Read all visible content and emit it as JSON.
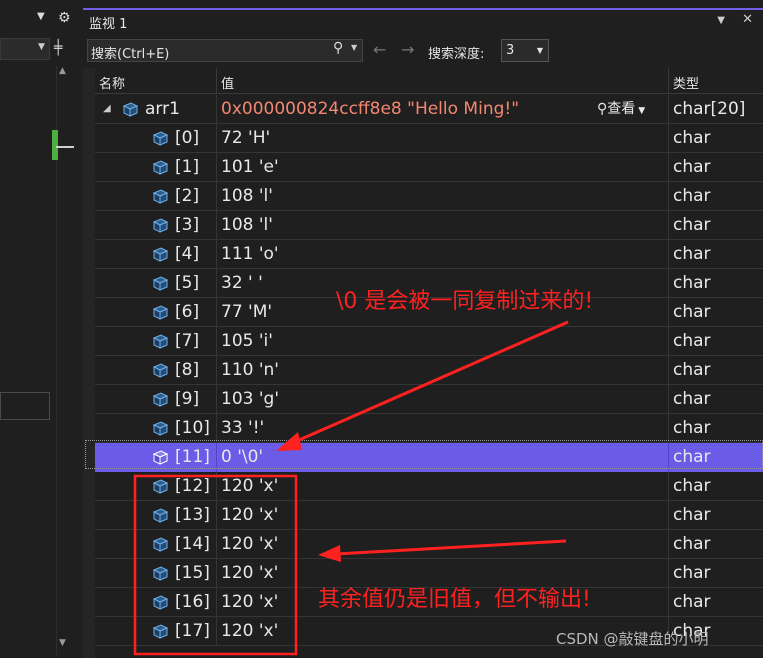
{
  "watch_window": {
    "title": "监视 1",
    "accent_color": "#7160e8",
    "title_buttons": [
      "chevron-down-icon",
      "close-icon"
    ],
    "search_placeholder": "搜索(Ctrl+E)",
    "search_icon": "search-icon",
    "depth_label": "搜索深度:",
    "depth_value": "3",
    "columns": {
      "name": "名称",
      "value": "值",
      "type": "类型"
    },
    "root": {
      "name": "arr1",
      "value": "0x000000824ccff8e8 \"Hello Ming!\"",
      "view_label": "查看",
      "type": "char[20]",
      "value_color": "#f48771"
    },
    "elements": [
      {
        "name": "[0]",
        "value": "72 'H'",
        "type": "char"
      },
      {
        "name": "[1]",
        "value": "101 'e'",
        "type": "char"
      },
      {
        "name": "[2]",
        "value": "108 'l'",
        "type": "char"
      },
      {
        "name": "[3]",
        "value": "108 'l'",
        "type": "char"
      },
      {
        "name": "[4]",
        "value": "111 'o'",
        "type": "char"
      },
      {
        "name": "[5]",
        "value": "32 ' '",
        "type": "char"
      },
      {
        "name": "[6]",
        "value": "77 'M'",
        "type": "char"
      },
      {
        "name": "[7]",
        "value": "105 'i'",
        "type": "char"
      },
      {
        "name": "[8]",
        "value": "110 'n'",
        "type": "char"
      },
      {
        "name": "[9]",
        "value": "103 'g'",
        "type": "char"
      },
      {
        "name": "[10]",
        "value": "33 '!'",
        "type": "char"
      },
      {
        "name": "[11]",
        "value": "0 '\\0'",
        "type": "char",
        "selected": true
      },
      {
        "name": "[12]",
        "value": "120 'x'",
        "type": "char"
      },
      {
        "name": "[13]",
        "value": "120 'x'",
        "type": "char"
      },
      {
        "name": "[14]",
        "value": "120 'x'",
        "type": "char"
      },
      {
        "name": "[15]",
        "value": "120 'x'",
        "type": "char"
      },
      {
        "name": "[16]",
        "value": "120 'x'",
        "type": "char"
      },
      {
        "name": "[17]",
        "value": "120 'x'",
        "type": "char"
      }
    ],
    "selected_color": "#6b5ce7"
  },
  "annotations": {
    "note_null": "\\0 是会被一同复制过来的!",
    "note_rest": "其余值仍是旧值，但不输出!",
    "color": "#ff2020"
  },
  "watermark": "CSDN @敲键盘的小明"
}
